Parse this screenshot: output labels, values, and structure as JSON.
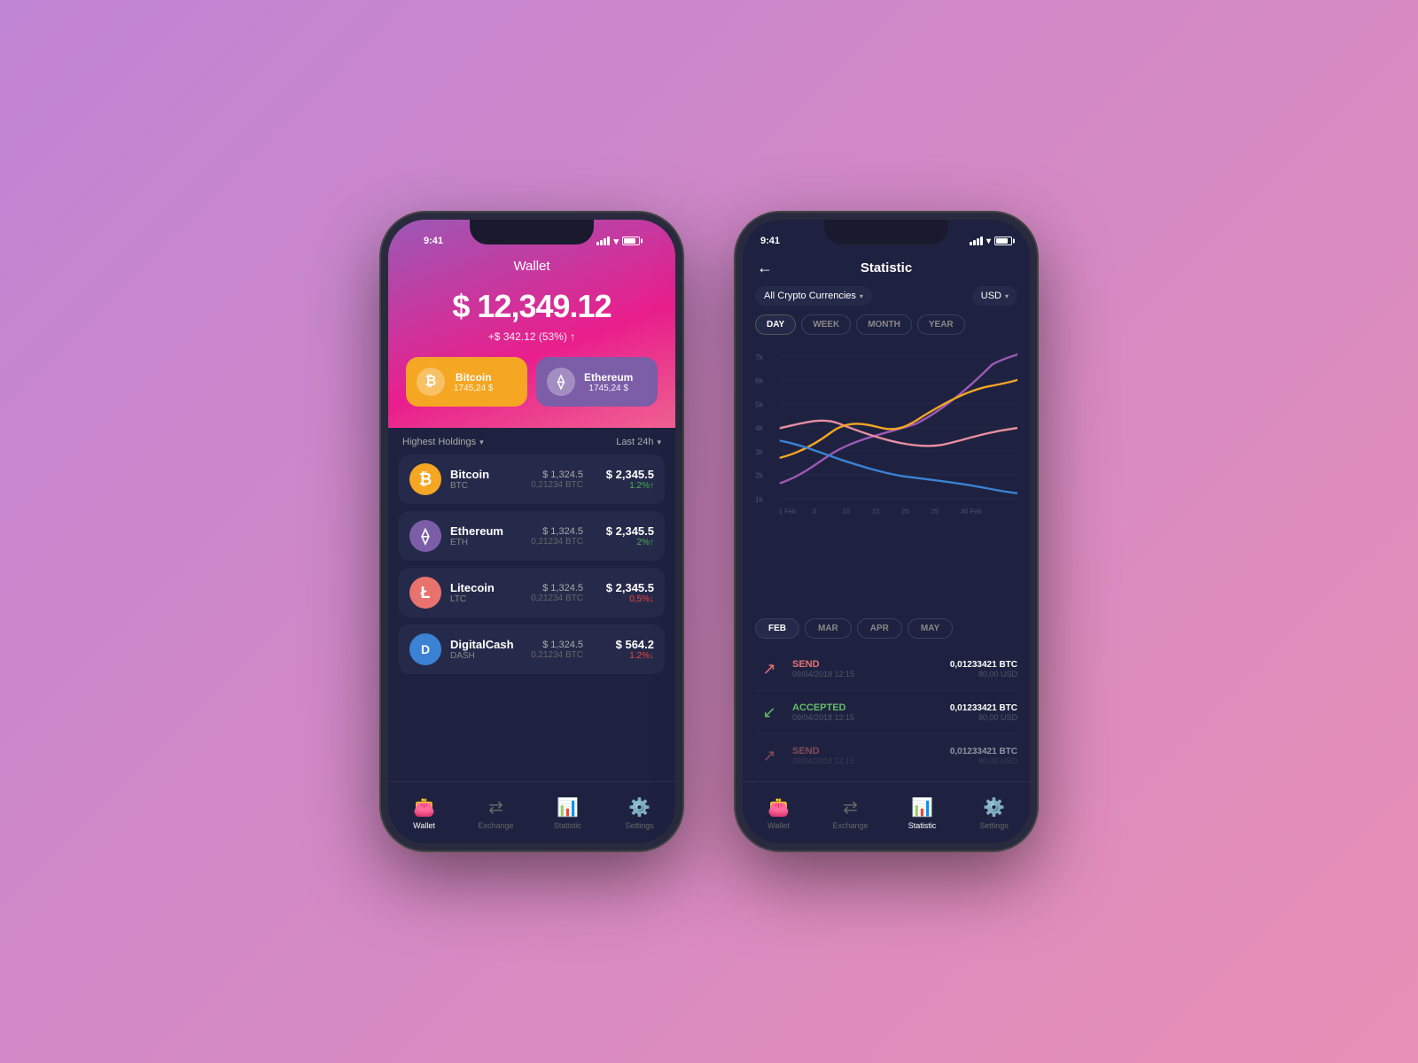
{
  "background": "#d48fd0",
  "phone1": {
    "status_time": "9:41",
    "title": "Wallet",
    "total_amount": "$ 12,349.12",
    "change": "+$ 342.12 (53%) ↑",
    "cards": [
      {
        "name": "Bitcoin",
        "value": "1745,24 $",
        "symbol": "₿",
        "type": "bitcoin"
      },
      {
        "name": "Ethereum",
        "value": "1745,24 $",
        "symbol": "⟠",
        "type": "ethereum"
      }
    ],
    "list_header_left": "Highest Holdings",
    "list_header_right": "Last 24h",
    "coins": [
      {
        "name": "Bitcoin",
        "symbol": "BTC",
        "price1": "$ 1,324.5",
        "btc": "0,21234 BTC",
        "price2": "$ 2,345.5",
        "change": "1.2%↑",
        "dir": "up",
        "icon": "₿",
        "type": "btc"
      },
      {
        "name": "Ethereum",
        "symbol": "ETH",
        "price1": "$ 1,324.5",
        "btc": "0,21234 BTC",
        "price2": "$ 2,345.5",
        "change": "2%↑",
        "dir": "up",
        "icon": "⟠",
        "type": "eth"
      },
      {
        "name": "Litecoin",
        "symbol": "LTC",
        "price1": "$ 1,324.5",
        "btc": "0,21234 BTC",
        "price2": "$ 2,345.5",
        "change": "0,5%↓",
        "dir": "down",
        "icon": "Ł",
        "type": "ltc"
      },
      {
        "name": "DigitalCash",
        "symbol": "DASH",
        "price1": "$ 1,324.5",
        "btc": "0,21234 BTC",
        "price2": "$ 564.2",
        "change": "1.2%↓",
        "dir": "down",
        "icon": "D",
        "type": "dash"
      }
    ],
    "nav": [
      {
        "label": "Wallet",
        "icon": "👛",
        "active": true
      },
      {
        "label": "Exchange",
        "icon": "⇄",
        "active": false
      },
      {
        "label": "Statistic",
        "icon": "📊",
        "active": false
      },
      {
        "label": "Settings",
        "icon": "⚙️",
        "active": false
      }
    ]
  },
  "phone2": {
    "status_time": "9:41",
    "title": "Statistic",
    "filter_left": "All Crypto Currencies",
    "filter_right": "USD",
    "periods": [
      "DAY",
      "WEEK",
      "MONTH",
      "YEAR"
    ],
    "active_period": "DAY",
    "y_labels": [
      "7k",
      "6k",
      "5k",
      "4k",
      "3k",
      "2k",
      "1k"
    ],
    "x_labels": [
      "1 Feb",
      "5",
      "10",
      "15",
      "20",
      "25",
      "30 Feb"
    ],
    "months": [
      "FEB",
      "MAR",
      "APR",
      "MAY"
    ],
    "active_month": "FEB",
    "transactions": [
      {
        "type": "SEND",
        "dir": "send",
        "date": "09/04/2018 12:15",
        "btc": "0,01233421 BTC",
        "usd": "80,00 USD"
      },
      {
        "type": "ACCEPTED",
        "dir": "accepted",
        "date": "09/04/2018 12:15",
        "btc": "0,01233421 BTC",
        "usd": "80,00 USD"
      },
      {
        "type": "SEND",
        "dir": "send",
        "date": "09/04/2018 12:15",
        "btc": "0,01233421 BTC",
        "usd": "80,00 USD"
      }
    ],
    "nav": [
      {
        "label": "Wallet",
        "icon": "👛",
        "active": false
      },
      {
        "label": "Exchange",
        "icon": "⇄",
        "active": false
      },
      {
        "label": "Statistic",
        "icon": "📊",
        "active": true
      },
      {
        "label": "Settings",
        "icon": "⚙️",
        "active": false
      }
    ]
  }
}
